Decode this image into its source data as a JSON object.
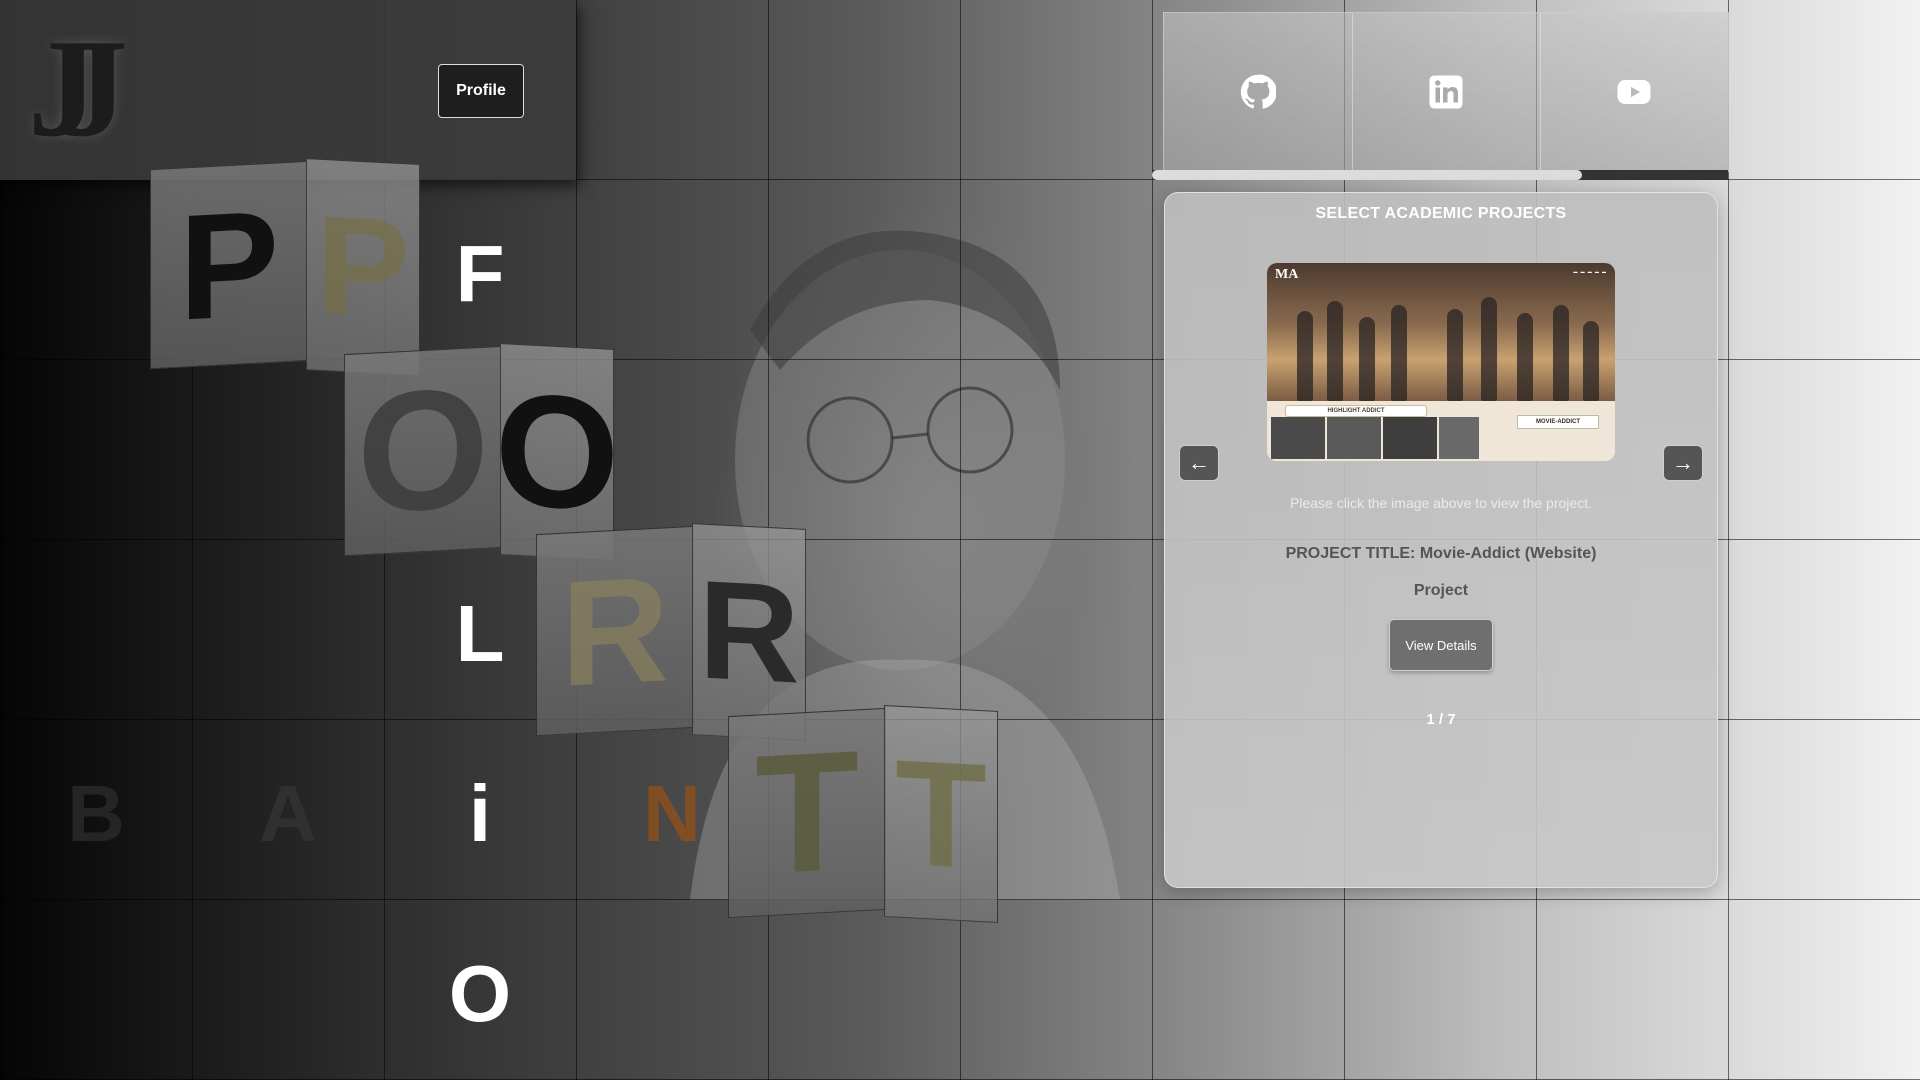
{
  "header": {
    "logo_text": "JJ",
    "profile_label": "Profile"
  },
  "social": {
    "items": [
      {
        "name": "github-icon"
      },
      {
        "name": "linkedin-icon"
      },
      {
        "name": "youtube-icon"
      }
    ]
  },
  "portfolio_letters": {
    "cube_p": "P",
    "f": "F",
    "cube_o": "O",
    "l": "L",
    "cube_r": "R",
    "i": "i",
    "cube_t": "T",
    "o_bottom": "O",
    "b": "B",
    "a": "A",
    "n": "N"
  },
  "panel": {
    "title": "SELECT ACADEMIC PROJECTS",
    "prev_label": "←",
    "next_label": "→",
    "hint": "Please click the image above to view the project.",
    "project_title_label": "PROJECT TITLE:",
    "project_title_value": "Movie-Addict (Website)",
    "project_title_line2": "Project",
    "details_label": "View Details",
    "pager": "1 / 7",
    "screenshot": {
      "logo": "MA",
      "highlight": "HIGHLIGHT ADDICT",
      "side_label": "MOVIE-ADDICT"
    }
  }
}
